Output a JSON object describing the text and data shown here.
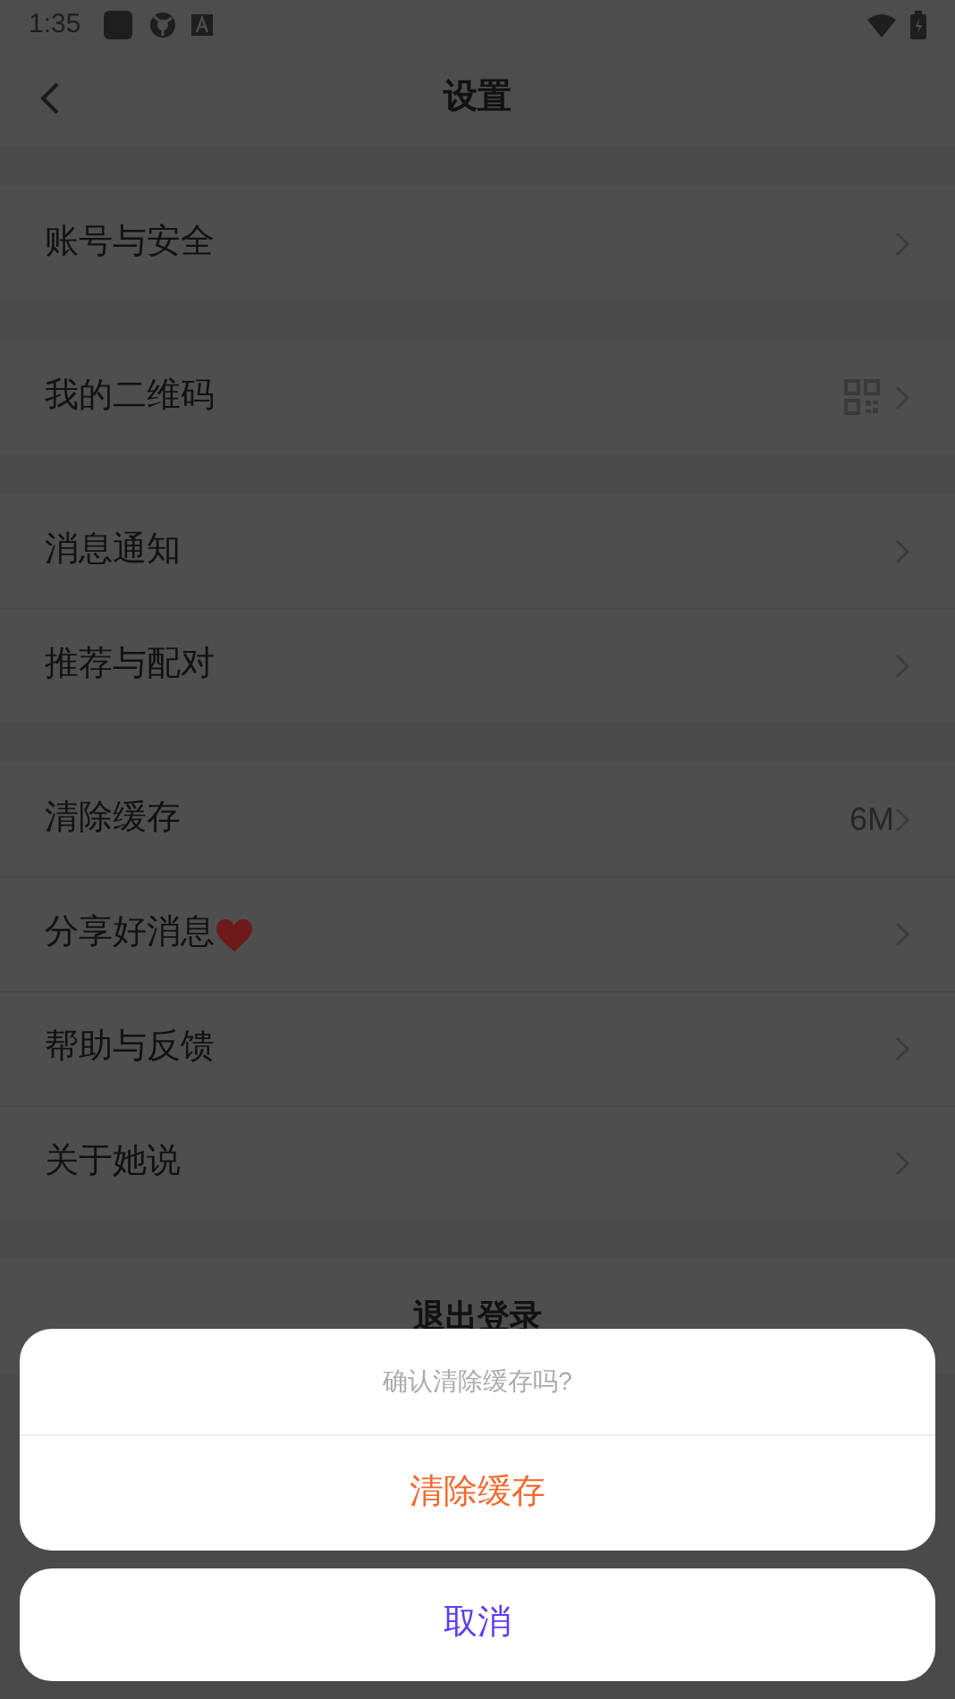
{
  "status_bar": {
    "time": "1:35"
  },
  "header": {
    "title": "设置"
  },
  "groups": [
    [
      {
        "kind": "plain",
        "label": "账号与安全"
      }
    ],
    [
      {
        "kind": "qr",
        "label": "我的二维码"
      }
    ],
    [
      {
        "kind": "plain",
        "label": "消息通知"
      },
      {
        "kind": "plain",
        "label": "推荐与配对"
      }
    ],
    [
      {
        "kind": "value",
        "label": "清除缓存",
        "value": "6M"
      },
      {
        "kind": "heart",
        "label": "分享好消息"
      },
      {
        "kind": "plain",
        "label": "帮助与反馈"
      },
      {
        "kind": "plain",
        "label": "关于她说"
      }
    ]
  ],
  "logout": {
    "label": "退出登录"
  },
  "sheet": {
    "message": "确认清除缓存吗?",
    "action": "清除缓存",
    "cancel": "取消"
  }
}
